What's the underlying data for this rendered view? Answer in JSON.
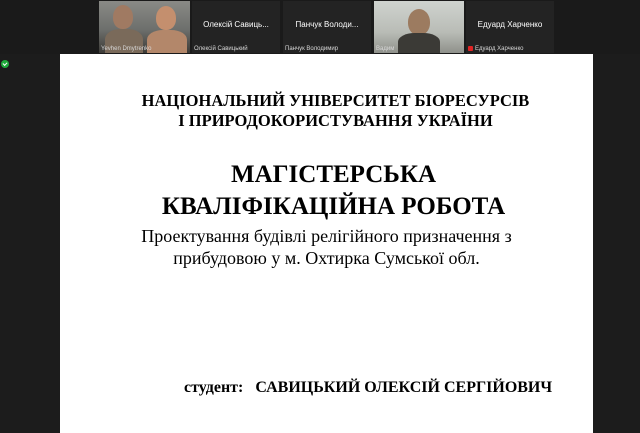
{
  "participants": [
    {
      "name": "Yevhen Dmytrenko",
      "center": ""
    },
    {
      "name": "Олексій Савицький",
      "center": "Олексій  Савиць..."
    },
    {
      "name": "Панчук Володимир",
      "center": "Панчук  Володи..."
    },
    {
      "name": "Вадим",
      "center": ""
    },
    {
      "name": "Едуард Харченко",
      "center": "Едуард Харченко"
    }
  ],
  "slide": {
    "university_line1": "НАЦІОНАЛЬНИЙ УНІВЕРСИТЕТ БІОРЕСУРСІВ",
    "university_line2": "І ПРИРОДОКОРИСТУВАННЯ УКРАЇНИ",
    "title_line1": "МАГІСТЕРСЬКА",
    "title_line2": "КВАЛІФІКАЦІЙНА РОБОТА",
    "project_line1": "Проектування будівлі релігійного призначення з",
    "project_line2": "прибудовою у м. Охтирка Сумської обл.",
    "student_label": "студент:",
    "student_name": "САВИЦЬКИЙ ОЛЕКСІЙ СЕРГІЙОВИЧ"
  },
  "colors": {
    "background": "#1c1c1c",
    "tile": "#232323",
    "mute": "#e02424",
    "secure": "#1faa3b"
  }
}
